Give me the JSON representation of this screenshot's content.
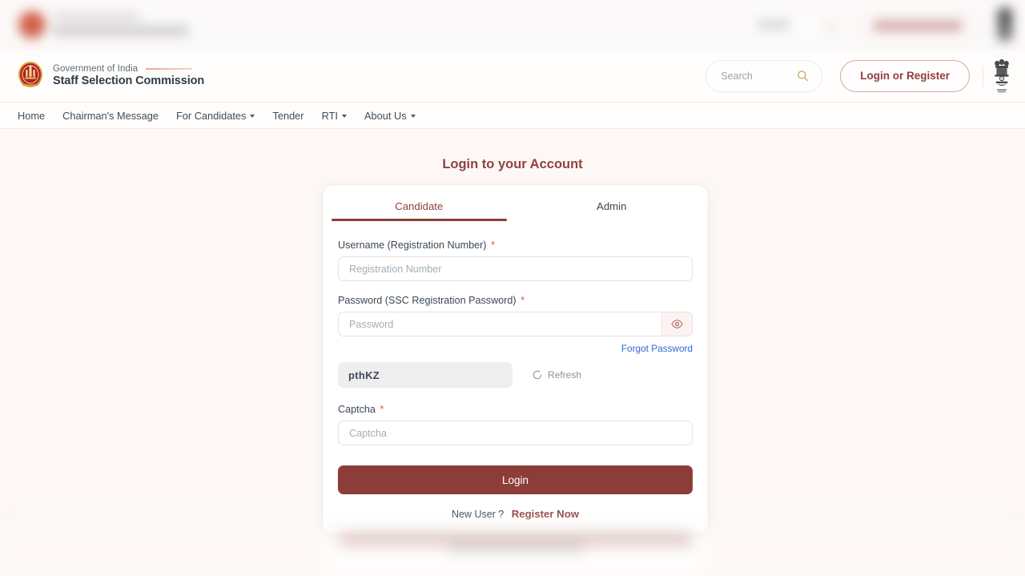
{
  "colors": {
    "brand_maroon": "#8c3d38",
    "brand_maroon_text": "#8e4340",
    "page_background": "#fdf8f6",
    "card_background": "#ffffff",
    "link_blue": "#2e6ad1",
    "required_red": "#e8533f",
    "captcha_background": "#efeeee"
  },
  "header": {
    "emblem_icon": "ssc-emblem-icon",
    "government_line": "Government of India",
    "organization_name": "Staff Selection Commission",
    "search": {
      "placeholder": "Search",
      "value": "",
      "icon": "search-icon"
    },
    "login_register_label": "Login or Register",
    "national_emblem_icon": "national-emblem-icon"
  },
  "nav": {
    "items": [
      {
        "label": "Home",
        "has_dropdown": false
      },
      {
        "label": "Chairman's Message",
        "has_dropdown": false
      },
      {
        "label": "For Candidates",
        "has_dropdown": true
      },
      {
        "label": "Tender",
        "has_dropdown": false
      },
      {
        "label": "RTI",
        "has_dropdown": true
      },
      {
        "label": "About Us",
        "has_dropdown": true
      }
    ]
  },
  "main": {
    "page_title": "Login to your Account",
    "tabs": [
      {
        "label": "Candidate",
        "active": true
      },
      {
        "label": "Admin",
        "active": false
      }
    ],
    "form": {
      "username": {
        "label": "Username (Registration Number)",
        "required_mark": "*",
        "placeholder": "Registration Number",
        "value": ""
      },
      "password": {
        "label": "Password (SSC Registration Password)",
        "required_mark": "*",
        "placeholder": "Password",
        "value": "",
        "toggle_icon": "eye-icon"
      },
      "forgot_password_label": "Forgot Password",
      "captcha_image_text": "pthKZ",
      "refresh": {
        "label": "Refresh",
        "icon": "refresh-icon"
      },
      "captcha": {
        "label": "Captcha",
        "required_mark": "*",
        "placeholder": "Captcha",
        "value": ""
      },
      "submit_label": "Login",
      "new_user_text": "New User ?",
      "register_label": "Register Now"
    }
  }
}
